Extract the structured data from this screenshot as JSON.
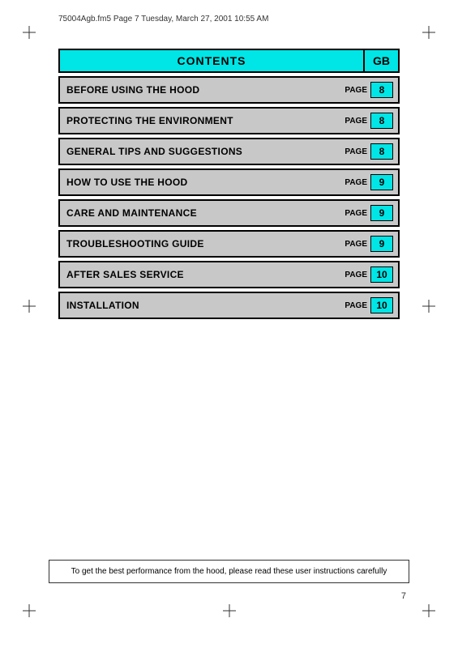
{
  "fileInfo": "75004Agb.fm5  Page 7  Tuesday, March 27, 2001  10:55 AM",
  "header": {
    "title": "CONTENTS",
    "gb": "GB"
  },
  "tocItems": [
    {
      "label": "BEFORE USING THE HOOD",
      "pageWord": "PAGE",
      "pageNum": "8"
    },
    {
      "label": "PROTECTING THE ENVIRONMENT",
      "pageWord": "PAGE",
      "pageNum": "8"
    },
    {
      "label": "GENERAL TIPS AND SUGGESTIONS",
      "pageWord": "PAGE",
      "pageNum": "8"
    },
    {
      "label": "HOW TO USE THE HOOD",
      "pageWord": "PAGE",
      "pageNum": "9"
    },
    {
      "label": "CARE AND MAINTENANCE",
      "pageWord": "PAGE",
      "pageNum": "9"
    },
    {
      "label": "TROUBLESHOOTING GUIDE",
      "pageWord": "PAGE",
      "pageNum": "9"
    },
    {
      "label": "AFTER SALES SERVICE",
      "pageWord": "PAGE",
      "pageNum": "10"
    },
    {
      "label": "INSTALLATION",
      "pageWord": "PAGE",
      "pageNum": "10"
    }
  ],
  "bottomNote": "To get the best performance from the hood, please read these user instructions carefully",
  "pageNumber": "7"
}
